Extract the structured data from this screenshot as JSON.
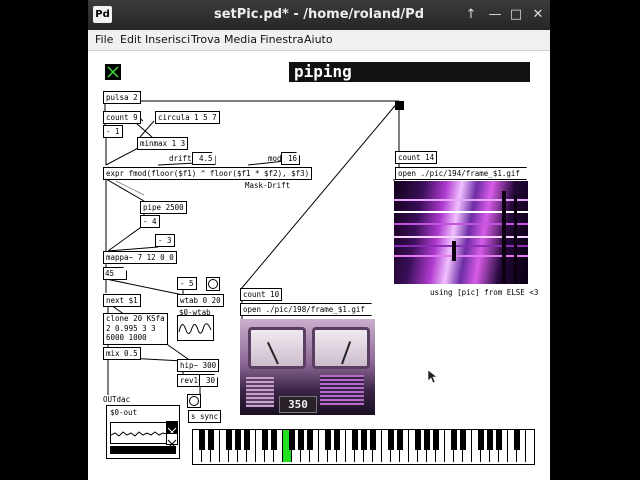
{
  "window": {
    "title": "setPic.pd* - /home/roland/Pd",
    "app_icon": "Pd",
    "controls": [
      "up-arrow-icon",
      "minimize-icon",
      "maximize-icon",
      "close-icon"
    ]
  },
  "menu": [
    "File",
    "Edit",
    "Inserisci",
    "Trova",
    "Media",
    "Finestra",
    "Aiuto"
  ],
  "patch": {
    "comment_title": "piping",
    "objects": {
      "pulsa": "pulsa 2",
      "count9": "count 9",
      "circula": "circula 1 5 7",
      "minus1": "- 1",
      "minmax": "minmax 1 3",
      "drift_label": "drift",
      "drift_val": "4.5",
      "mod_label": "mod",
      "mod_val": "16",
      "expr": "expr fmod(floor($f1) ^ floor($f1 * $f2), $f3)",
      "mask_drift": "Mask-Drift",
      "pipe": "pipe 2500",
      "minus4": "- 4",
      "minus3": "- 3",
      "mappa": "mappa~ 7 12 0 0",
      "num45": "45",
      "minus5": "- 5",
      "next": "next $1",
      "wtab": "wtab 0 20",
      "wtab_label": "$0-wtab",
      "clone_line1": "clone 20 KSfa",
      "clone_line2": "2 0.995 3 3",
      "clone_line3": "6000 1000",
      "mix": "mix 0.5",
      "hip": "hip~ 300",
      "rev1": "rev1~",
      "rev1_num": "30",
      "outdac": "OUTdac",
      "out_label": "$0-out",
      "ssync": "s sync",
      "count14": "count 14",
      "open194": "open ./pic/194/frame_$1.gif",
      "count10": "count 10",
      "open198": "open ./pic/198/frame_$1.gif",
      "using": "using [pic] from ELSE <3"
    },
    "image_readout": "350"
  }
}
